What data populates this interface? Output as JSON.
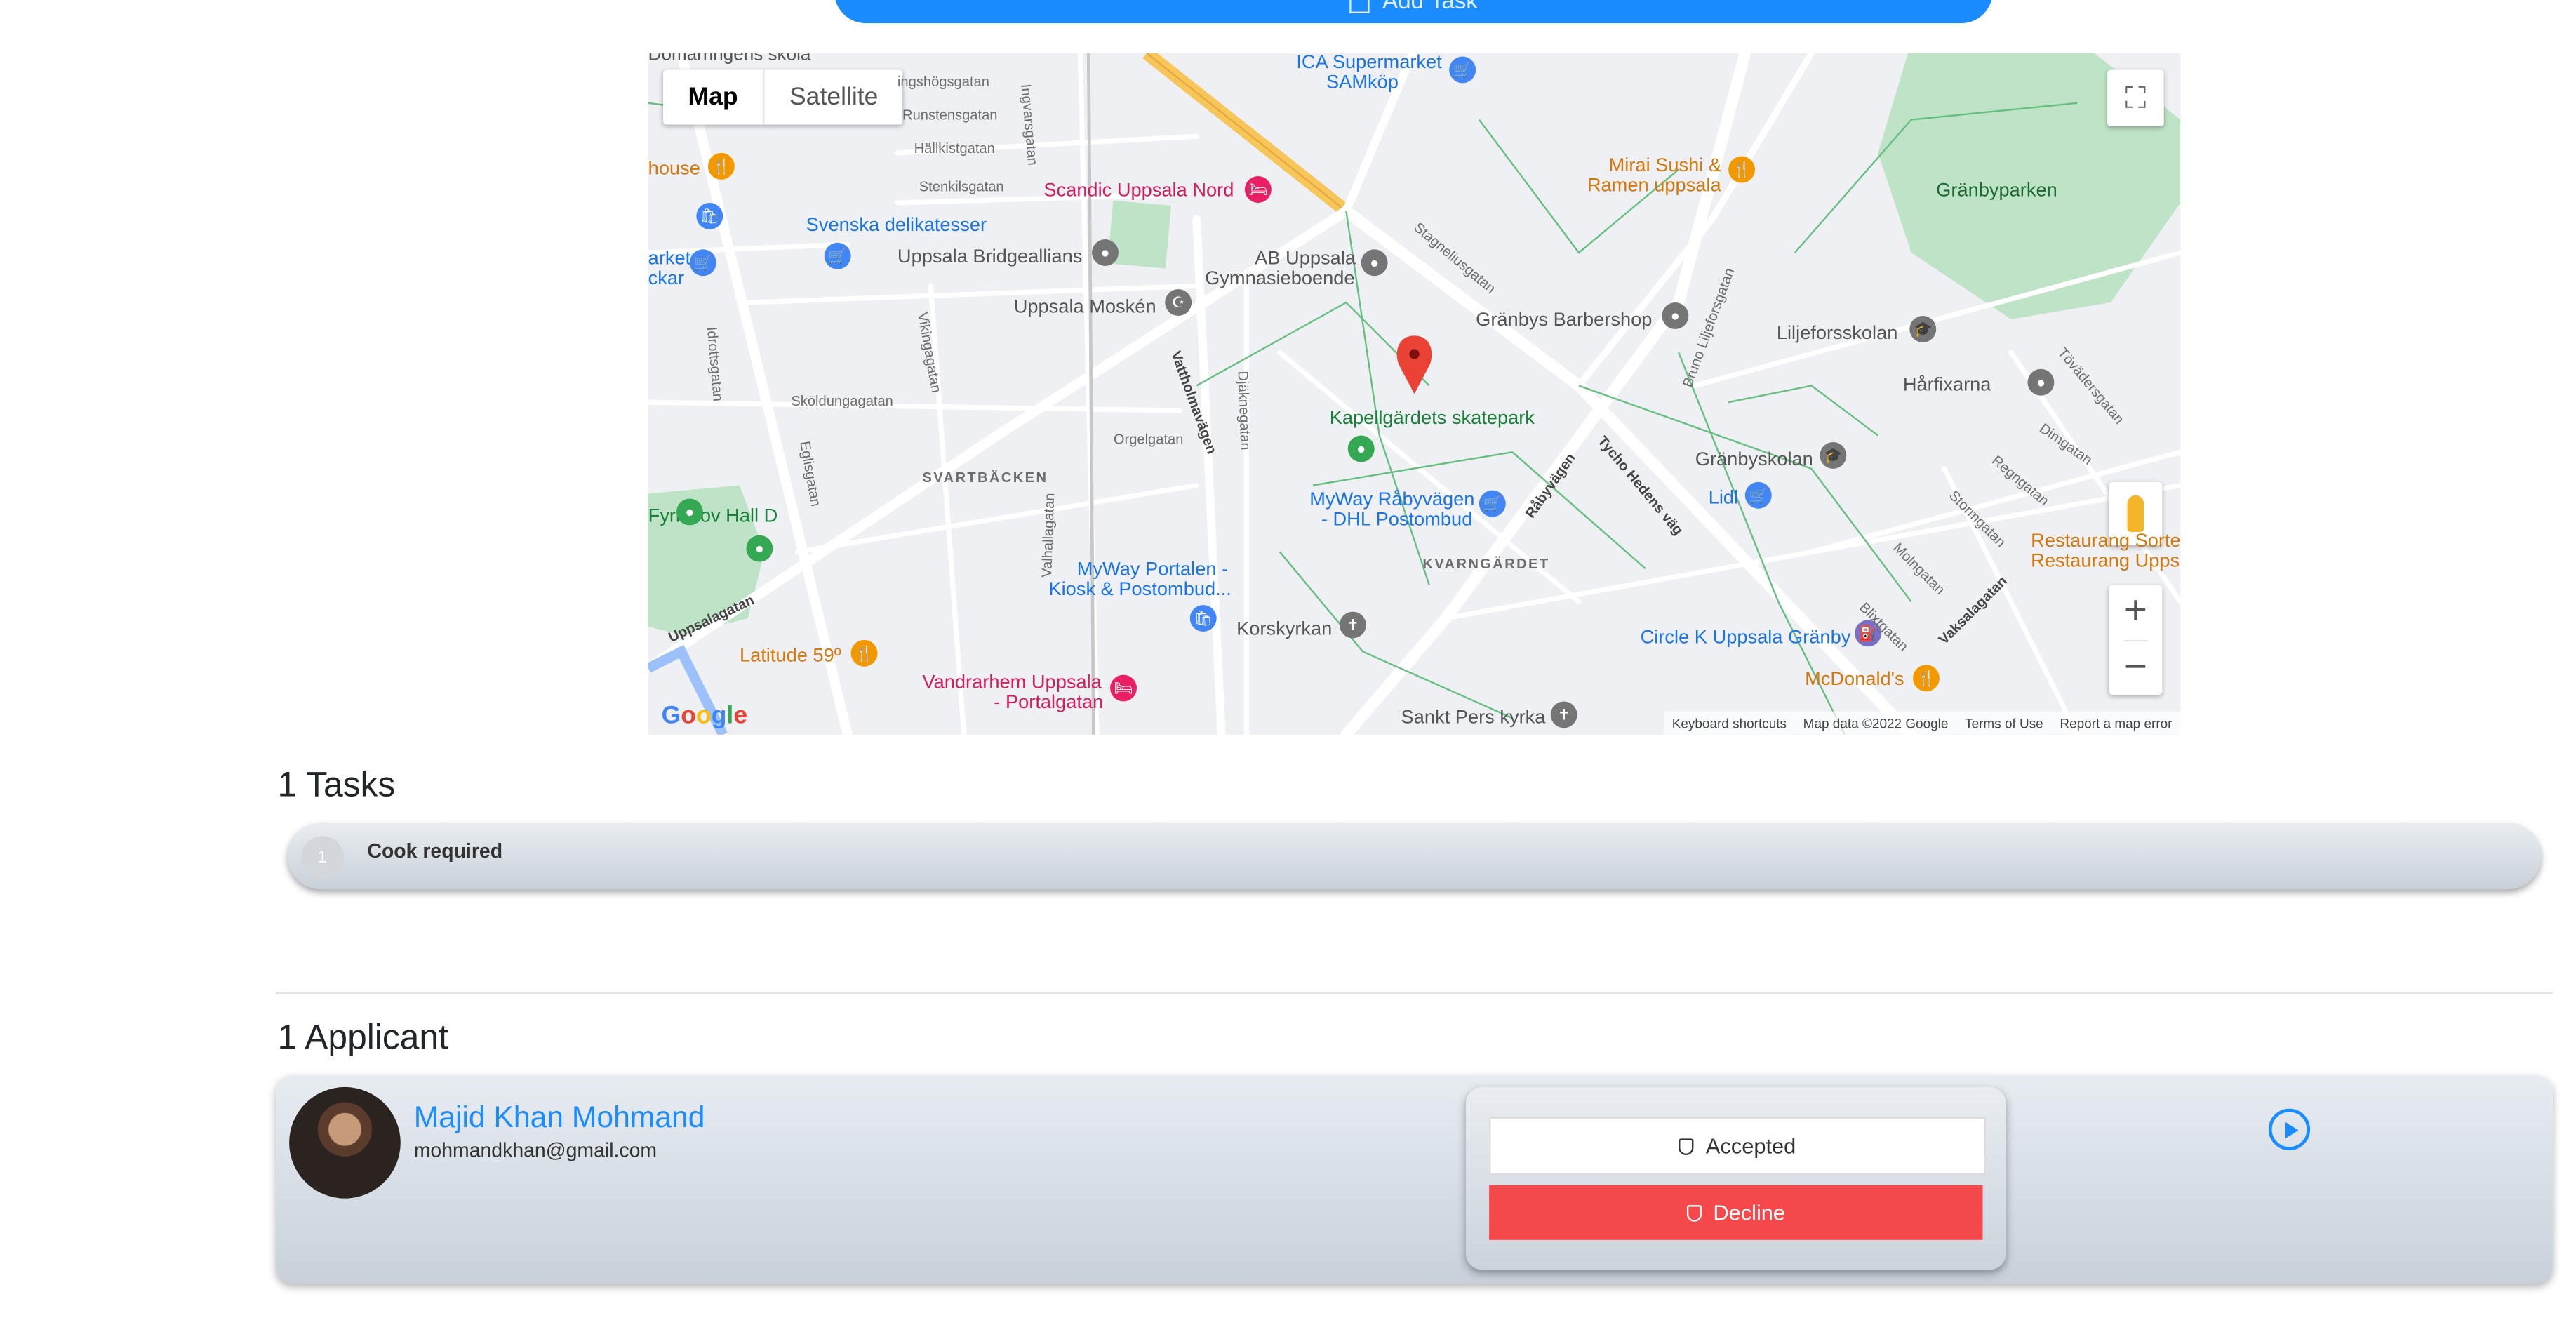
{
  "top_button": {
    "label": "Add Task"
  },
  "map": {
    "type_buttons": {
      "map": "Map",
      "satellite": "Satellite"
    },
    "labels": {
      "ica": "ICA Supermarket",
      "ica2": "SAMköp",
      "mirai1": "Mirai Sushi &",
      "mirai2": "Ramen uppsala",
      "granbyparken": "Gränbyparken",
      "house": "house",
      "scandic": "Scandic Uppsala Nord",
      "svenska": "Svenska delikatesser",
      "bridge": "Uppsala Bridgeallians",
      "ab1": "AB Uppsala",
      "ab2": "Gymnasieboende",
      "market1": "arket",
      "market2": "ckar",
      "moskén": "Uppsala Moskén",
      "barbershop": "Gränbys Barbershop",
      "liljefors": "Liljeforsskolan",
      "harfixarna": "Hårfixarna",
      "skatepark": "Kapellgärdets skatepark",
      "granbyskolan": "Gränbyskolan",
      "lidl": "Lidl",
      "fyrishov": "Fyrishov Hall D",
      "myway1a": "MyWay Råbyvägen",
      "myway1b": "- DHL Postombud",
      "restaurang1": "Restaurang Sorte",
      "restaurang2": "Restaurang Upps",
      "myway2a": "MyWay Portalen -",
      "myway2b": "Kiosk & Postombud...",
      "korskyrkan": "Korskyrkan",
      "circlek": "Circle K Uppsala Gränby",
      "latitude": "Latitude 59º",
      "mcdonalds": "McDonald's",
      "vandrarhem1": "Vandrarhem Uppsala",
      "vandrarhem2": "- Portalgatan",
      "sanktpers": "Sankt Pers kyrka",
      "svartbacken": "SVARTBÄCKEN",
      "kvarngardet": "KVARNGÄRDET"
    },
    "streets": {
      "s1": "Runstensgatan",
      "s2": "Hällkistgatan",
      "s3": "Stenkilsgatan",
      "s4": "Sköldungagatan",
      "s5": "Orgelgatan",
      "s6": "Vattholmavägen",
      "s7": "Råbyvägen",
      "s8": "Tycho Hedens väg",
      "s9": "Uppsalagatan",
      "s10": "Stagneliusgatan",
      "s11": "Ingvarsgatan",
      "s12": "Vikingagatan",
      "s13": "Djäknegatan",
      "s14": "Valhallagatan",
      "s15": "Dimgatan",
      "s16": "Vaksalagatan",
      "s17": "Molngatan",
      "s18": "Stormgatan",
      "s19": "Blixtgatan",
      "s20": "Bruno Liljeforsgatan",
      "s21": "Tövädersgatan",
      "s22": "Regngatan",
      "s23": "Idrottsgatan",
      "s24": "Eglisgatan",
      "s25": "ingshögsgatan"
    },
    "footer": {
      "shortcuts": "Keyboard shortcuts",
      "data": "Map data ©2022 Google",
      "terms": "Terms of Use",
      "report": "Report a map error"
    },
    "google": "Google",
    "top_partial": "Domarringens skola"
  },
  "tasks": {
    "heading": "1 Tasks",
    "items": [
      {
        "number": "1",
        "text": "Cook required"
      }
    ]
  },
  "applicants": {
    "heading": "1 Applicant",
    "items": [
      {
        "name": "Majid Khan Mohmand",
        "email": "mohmandkhan@gmail.com",
        "accepted_label": "Accepted",
        "decline_label": "Decline"
      }
    ]
  },
  "colors": {
    "primary": "#1a8cff",
    "decline": "#f5484b"
  }
}
